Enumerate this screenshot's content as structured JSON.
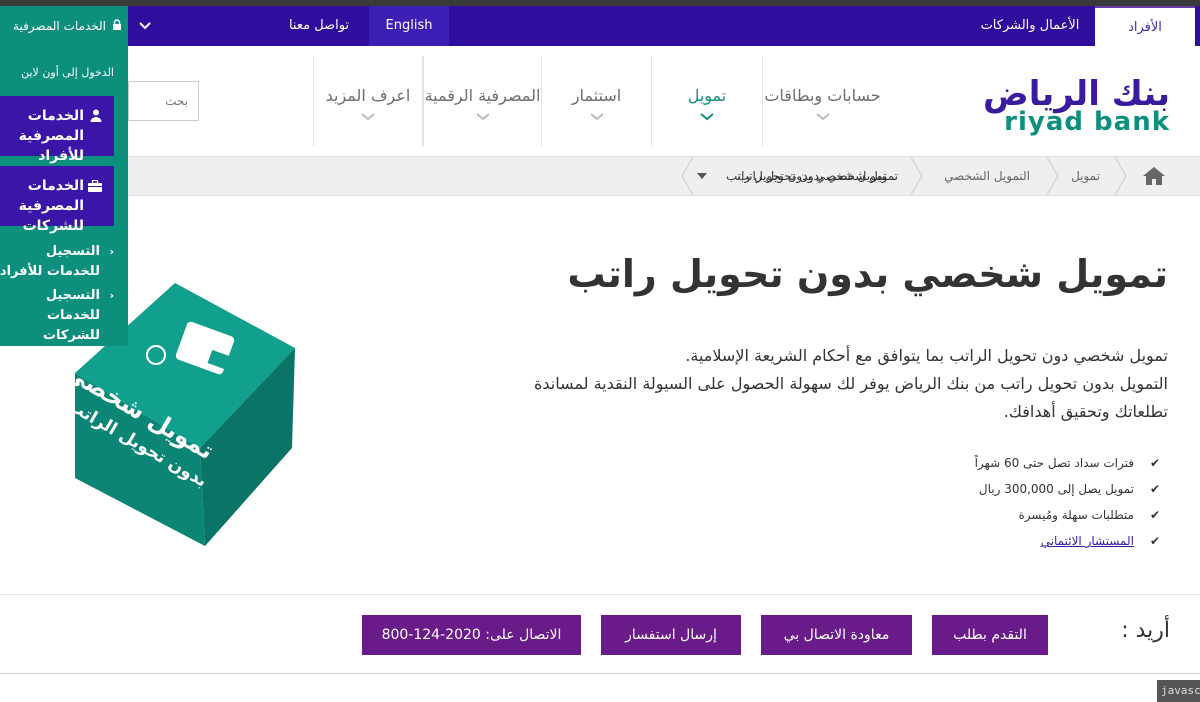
{
  "topbar": {
    "individuals": "الأفراد",
    "business": "الأعمال والشركات",
    "english": "English",
    "contact": "تواصل معنا"
  },
  "online_banking": {
    "header": "الخدمات المصرفية",
    "login_text": "الدخول إلى أون لاين",
    "individuals_button": "الخدمات المصرفية للأفراد",
    "business_button": "الخدمات المصرفية للشركات",
    "register_individuals": "التسجيل للخدمات للأفراد",
    "register_business": "التسجيل للخدمات للشركات"
  },
  "logo": {
    "arabic": "بنك الرياض",
    "english": "riyad bank"
  },
  "nav": {
    "accounts": "حسابات وبطاقات",
    "finance": "تمويل",
    "invest": "استثمار",
    "digital": "المصرفية الرقمية",
    "more": "اعرف المزيد"
  },
  "search": {
    "placeholder": "بحث"
  },
  "breadcrumb": {
    "finance": "تمويل",
    "personal": "التمويل الشخصي",
    "current": "تمويل شخصي بدون تحويل راتب",
    "dropdown": "تمويل شخصي بدون تحويل راتب"
  },
  "content": {
    "title": "تمويل شخصي بدون تحويل راتب",
    "desc_line1": "تمويل شخصي دون تحويل الراتب بما يتوافق مع أحكام الشريعة الإسلامية.",
    "desc_line2": "التمويل بدون تحويل راتب من بنك الرياض يوفر لك سهولة الحصول على السيولة النقدية لمساندة تطلعاتك وتحقيق أهدافك.",
    "bullets": [
      "فترات سداد تصل حتى 60 شهراً",
      "تمويل يصل إلى 300,000 ريال",
      "متطلبات سهلة ومُيسرة",
      "المستشار الائتماني"
    ],
    "cube_line1": "تمويل شخصي",
    "cube_line2": "بدون تحويل الراتب"
  },
  "cta": {
    "want": "أريد :",
    "apply": "التقدم بطلب",
    "callback": "معاودة الاتصال بي",
    "inquiry": "إرسال استفسار",
    "call": "الاتصال على: 2020-124-800"
  },
  "status_tooltip": "javascri",
  "colors": {
    "purple_bar": "#2f0e9e",
    "teal": "#0d8f7e",
    "cta_purple": "#6a1b8a"
  }
}
